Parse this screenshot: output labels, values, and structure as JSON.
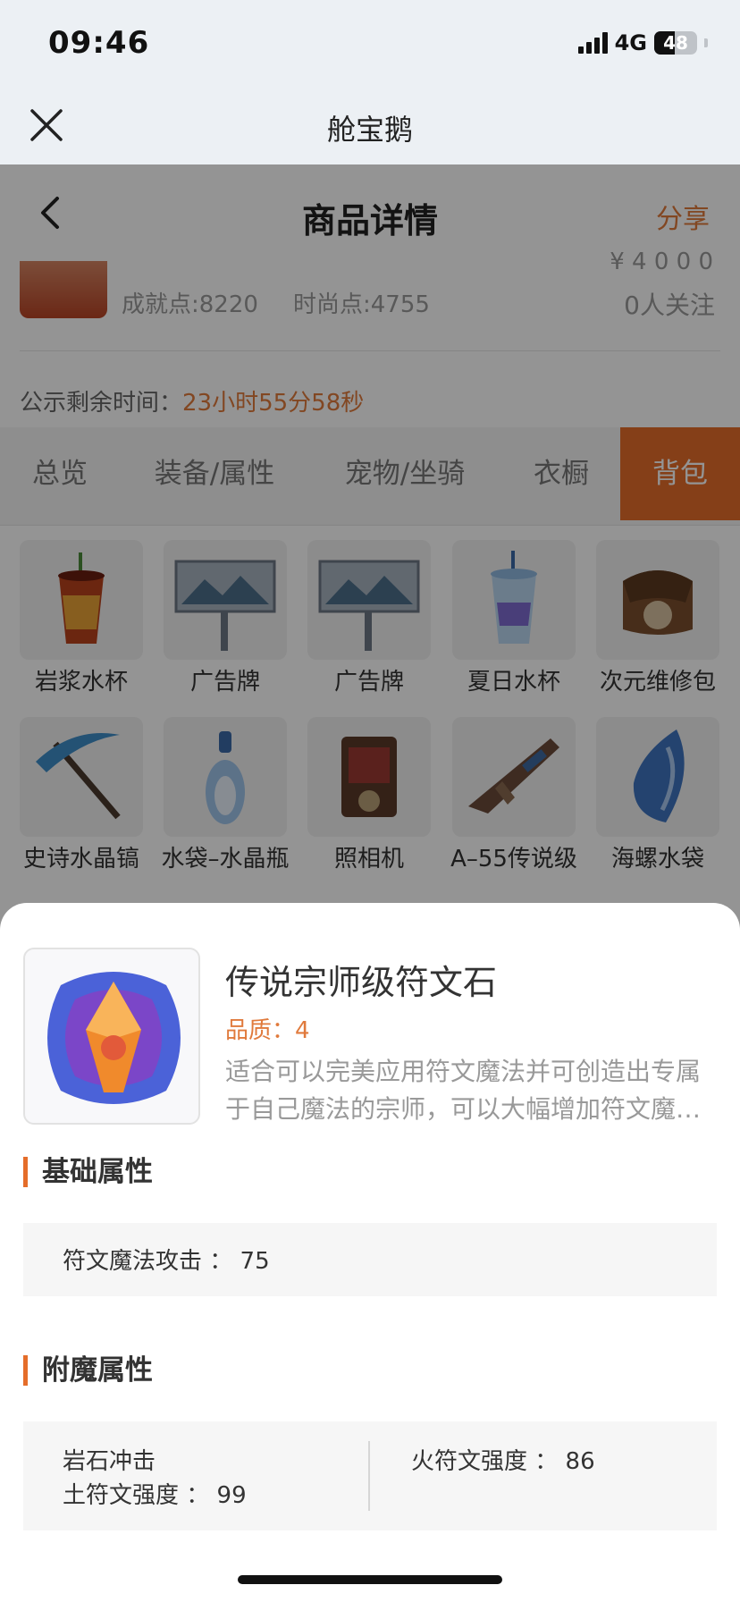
{
  "status_bar": {
    "time": "09:46",
    "network": "4G",
    "battery": "48",
    "battery_level": 0.48
  },
  "app_header": {
    "title": "舱宝鹅",
    "close_icon": "close-icon"
  },
  "page_header": {
    "title": "商品详情",
    "share_label": "分享",
    "back_icon": "chevron-left-icon"
  },
  "profile": {
    "achievement": "成就点:8220",
    "fashion": "时尚点:4755",
    "price_partial": "¥ 4 0 0 0",
    "followers": "0人关注",
    "public_label": "公示剩余时间：",
    "countdown": "23小时55分58秒"
  },
  "tabs": [
    {
      "label": "总览",
      "active": false
    },
    {
      "label": "装备/属性",
      "active": false
    },
    {
      "label": "宠物/坐骑",
      "active": false
    },
    {
      "label": "衣橱",
      "active": false
    },
    {
      "label": "背包",
      "active": true
    }
  ],
  "inventory": [
    {
      "name": "岩浆水杯",
      "icon": "lava-cup-icon"
    },
    {
      "name": "广告牌",
      "icon": "billboard-icon"
    },
    {
      "name": "广告牌",
      "icon": "billboard-icon"
    },
    {
      "name": "夏日水杯",
      "icon": "summer-cup-icon"
    },
    {
      "name": "次元维修包",
      "icon": "repair-bag-icon"
    },
    {
      "name": "史诗水晶镐",
      "icon": "crystal-pickaxe-icon"
    },
    {
      "name": "水袋–水晶瓶",
      "icon": "crystal-bottle-icon"
    },
    {
      "name": "照相机",
      "icon": "camera-icon"
    },
    {
      "name": "A–55传说级",
      "icon": "rifle-icon"
    },
    {
      "name": "海螺水袋",
      "icon": "conch-bag-icon"
    }
  ],
  "sheet": {
    "item_name": "传说宗师级符文石",
    "quality": "品质：4",
    "desc_line1": "适合可以完美应用符文魔法并可创造出专属",
    "desc_line2": "于自己魔法的宗师，可以大幅增加符文魔…",
    "image_icon": "rune-stone-icon",
    "basic_section": "基础属性",
    "basic_attr": "符文魔法攻击 ： 75",
    "enchant_section": "附魔属性",
    "enchant_left_1": "岩石冲击",
    "enchant_left_2": "土符文强度 ： 99",
    "enchant_right_1": "火符文强度 ： 86"
  },
  "colors": {
    "accent": "#e56d2a",
    "accent_text": "#e07a3c"
  }
}
